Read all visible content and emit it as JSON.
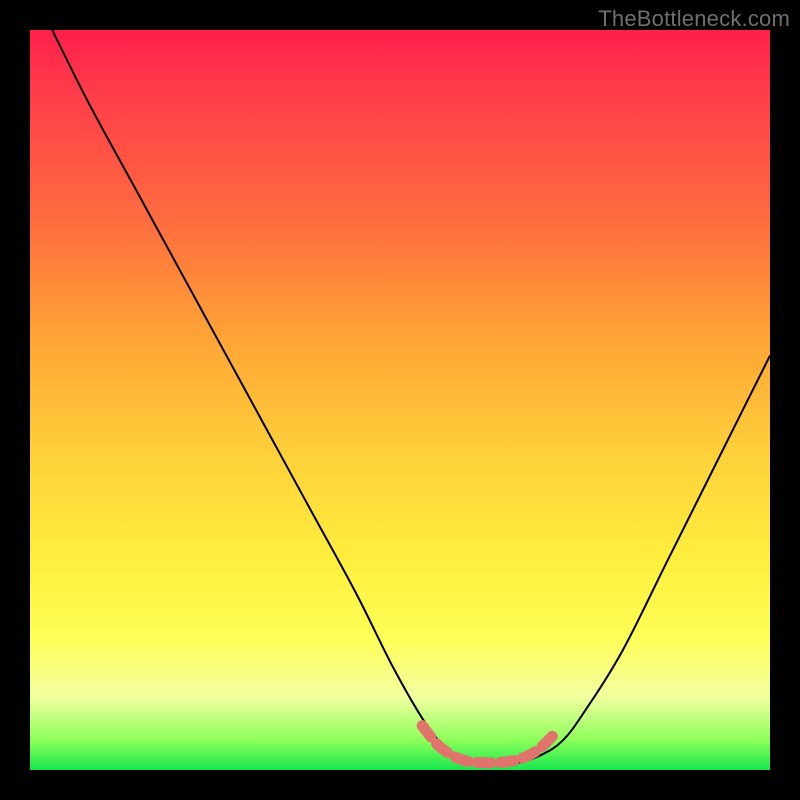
{
  "watermark": "TheBottleneck.com",
  "chart_data": {
    "type": "line",
    "title": "",
    "xlabel": "",
    "ylabel": "",
    "xlim": [
      0,
      100
    ],
    "ylim": [
      0,
      100
    ],
    "grid": false,
    "series": [
      {
        "name": "bottleneck-curve",
        "color": "#000000",
        "stroke_width": 2,
        "x": [
          3,
          8,
          14,
          20,
          26,
          32,
          38,
          44,
          49,
          53,
          56,
          58,
          60,
          63,
          66,
          69,
          72,
          75,
          80,
          86,
          92,
          100
        ],
        "y": [
          100,
          90,
          79,
          68,
          57,
          46,
          35,
          24,
          14,
          7,
          3,
          1,
          1,
          1,
          1,
          2,
          4,
          8,
          16,
          28,
          40,
          56
        ]
      },
      {
        "name": "optimal-band",
        "color": "#e0736b",
        "stroke_width": 11,
        "x": [
          53,
          55,
          57,
          59,
          61,
          63,
          65,
          67,
          69,
          71
        ],
        "y": [
          6,
          3.5,
          2,
          1.2,
          1,
          1,
          1.2,
          1.8,
          3,
          5
        ]
      }
    ],
    "annotations": []
  }
}
